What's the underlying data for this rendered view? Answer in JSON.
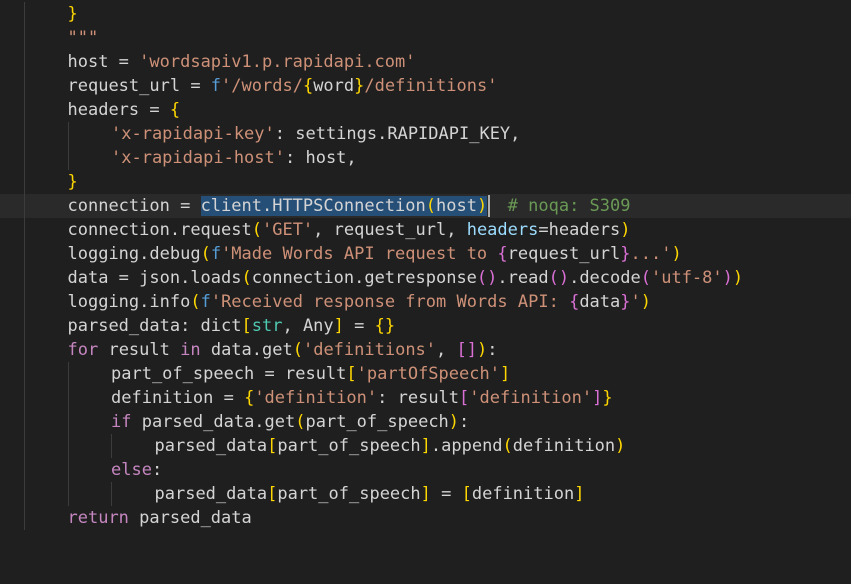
{
  "editor": {
    "language": "python",
    "lines": [
      {
        "indent": 1,
        "tokens": [
          {
            "t": "}",
            "c": "br1"
          }
        ]
      },
      {
        "indent": 1,
        "tokens": [
          {
            "t": "\"\"\"",
            "c": "str"
          }
        ]
      },
      {
        "indent": 1,
        "tokens": [
          {
            "t": "host = ",
            "c": "plain"
          },
          {
            "t": "'wordsapiv1.p.rapidapi.com'",
            "c": "str"
          }
        ]
      },
      {
        "indent": 1,
        "tokens": [
          {
            "t": "request_url = ",
            "c": "plain"
          },
          {
            "t": "f",
            "c": "kw2"
          },
          {
            "t": "'/words/",
            "c": "str"
          },
          {
            "t": "{",
            "c": "br1"
          },
          {
            "t": "word",
            "c": "plain"
          },
          {
            "t": "}",
            "c": "br1"
          },
          {
            "t": "/definitions'",
            "c": "str"
          }
        ]
      },
      {
        "indent": 1,
        "tokens": [
          {
            "t": "headers = ",
            "c": "plain"
          },
          {
            "t": "{",
            "c": "br1"
          }
        ]
      },
      {
        "indent": 2,
        "tokens": [
          {
            "t": "'x-rapidapi-key'",
            "c": "str"
          },
          {
            "t": ": settings.RAPIDAPI_KEY,",
            "c": "plain"
          }
        ]
      },
      {
        "indent": 2,
        "tokens": [
          {
            "t": "'x-rapidapi-host'",
            "c": "str"
          },
          {
            "t": ": host,",
            "c": "plain"
          }
        ]
      },
      {
        "indent": 1,
        "tokens": [
          {
            "t": "}",
            "c": "br1"
          }
        ]
      },
      {
        "indent": 1,
        "current": true,
        "tokens": [
          {
            "t": "connection = ",
            "c": "plain"
          },
          {
            "t": "client.HTTPSConnection",
            "c": "plain",
            "sel": true
          },
          {
            "t": "(",
            "c": "br1",
            "sel": true
          },
          {
            "t": "host",
            "c": "plain",
            "sel": true
          },
          {
            "t": ")",
            "c": "br1",
            "sel": true
          },
          {
            "t": "  ",
            "c": "plain"
          },
          {
            "t": "# noqa: S309",
            "c": "cmt"
          }
        ]
      },
      {
        "indent": 1,
        "tokens": [
          {
            "t": "connection.request",
            "c": "plain"
          },
          {
            "t": "(",
            "c": "br1"
          },
          {
            "t": "'GET'",
            "c": "str"
          },
          {
            "t": ", request_url, ",
            "c": "plain"
          },
          {
            "t": "headers",
            "c": "param"
          },
          {
            "t": "=headers",
            "c": "plain"
          },
          {
            "t": ")",
            "c": "br1"
          }
        ]
      },
      {
        "indent": 1,
        "tokens": [
          {
            "t": "logging.debug",
            "c": "plain"
          },
          {
            "t": "(",
            "c": "br1"
          },
          {
            "t": "f",
            "c": "kw2"
          },
          {
            "t": "'Made Words API request to ",
            "c": "str"
          },
          {
            "t": "{",
            "c": "br2"
          },
          {
            "t": "request_url",
            "c": "plain"
          },
          {
            "t": "}",
            "c": "br2"
          },
          {
            "t": "...'",
            "c": "str"
          },
          {
            "t": ")",
            "c": "br1"
          }
        ]
      },
      {
        "indent": 1,
        "tokens": [
          {
            "t": "data = json.loads",
            "c": "plain"
          },
          {
            "t": "(",
            "c": "br1"
          },
          {
            "t": "connection.getresponse",
            "c": "plain"
          },
          {
            "t": "()",
            "c": "br2"
          },
          {
            "t": ".read",
            "c": "plain"
          },
          {
            "t": "()",
            "c": "br2"
          },
          {
            "t": ".decode",
            "c": "plain"
          },
          {
            "t": "(",
            "c": "br2"
          },
          {
            "t": "'utf-8'",
            "c": "str"
          },
          {
            "t": ")",
            "c": "br2"
          },
          {
            "t": ")",
            "c": "br1"
          }
        ]
      },
      {
        "indent": 1,
        "tokens": [
          {
            "t": "logging.info",
            "c": "plain"
          },
          {
            "t": "(",
            "c": "br1"
          },
          {
            "t": "f",
            "c": "kw2"
          },
          {
            "t": "'Received response from Words API: ",
            "c": "str"
          },
          {
            "t": "{",
            "c": "br2"
          },
          {
            "t": "data",
            "c": "plain"
          },
          {
            "t": "}",
            "c": "br2"
          },
          {
            "t": "'",
            "c": "str"
          },
          {
            "t": ")",
            "c": "br1"
          }
        ]
      },
      {
        "indent": 1,
        "tokens": [
          {
            "t": "parsed_data: dict",
            "c": "plain"
          },
          {
            "t": "[",
            "c": "br1"
          },
          {
            "t": "str",
            "c": "type"
          },
          {
            "t": ", Any",
            "c": "plain"
          },
          {
            "t": "]",
            "c": "br1"
          },
          {
            "t": " = ",
            "c": "plain"
          },
          {
            "t": "{}",
            "c": "br1"
          }
        ]
      },
      {
        "indent": 1,
        "tokens": [
          {
            "t": "for",
            "c": "kw"
          },
          {
            "t": " result ",
            "c": "plain"
          },
          {
            "t": "in",
            "c": "kw"
          },
          {
            "t": " data.get",
            "c": "plain"
          },
          {
            "t": "(",
            "c": "br1"
          },
          {
            "t": "'definitions'",
            "c": "str"
          },
          {
            "t": ", ",
            "c": "plain"
          },
          {
            "t": "[]",
            "c": "br2"
          },
          {
            "t": ")",
            "c": "br1"
          },
          {
            "t": ":",
            "c": "plain"
          }
        ]
      },
      {
        "indent": 2,
        "tokens": [
          {
            "t": "part_of_speech = result",
            "c": "plain"
          },
          {
            "t": "[",
            "c": "br1"
          },
          {
            "t": "'partOfSpeech'",
            "c": "str"
          },
          {
            "t": "]",
            "c": "br1"
          }
        ]
      },
      {
        "indent": 2,
        "tokens": [
          {
            "t": "definition = ",
            "c": "plain"
          },
          {
            "t": "{",
            "c": "br1"
          },
          {
            "t": "'definition'",
            "c": "str"
          },
          {
            "t": ": result",
            "c": "plain"
          },
          {
            "t": "[",
            "c": "br2"
          },
          {
            "t": "'definition'",
            "c": "str"
          },
          {
            "t": "]",
            "c": "br2"
          },
          {
            "t": "}",
            "c": "br1"
          }
        ]
      },
      {
        "indent": 2,
        "tokens": [
          {
            "t": "if",
            "c": "kw"
          },
          {
            "t": " parsed_data.get",
            "c": "plain"
          },
          {
            "t": "(",
            "c": "br1"
          },
          {
            "t": "part_of_speech",
            "c": "plain"
          },
          {
            "t": ")",
            "c": "br1"
          },
          {
            "t": ":",
            "c": "plain"
          }
        ]
      },
      {
        "indent": 3,
        "tokens": [
          {
            "t": "parsed_data",
            "c": "plain"
          },
          {
            "t": "[",
            "c": "br1"
          },
          {
            "t": "part_of_speech",
            "c": "plain"
          },
          {
            "t": "]",
            "c": "br1"
          },
          {
            "t": ".append",
            "c": "plain"
          },
          {
            "t": "(",
            "c": "br1"
          },
          {
            "t": "definition",
            "c": "plain"
          },
          {
            "t": ")",
            "c": "br1"
          }
        ]
      },
      {
        "indent": 2,
        "tokens": [
          {
            "t": "else",
            "c": "kw"
          },
          {
            "t": ":",
            "c": "plain"
          }
        ]
      },
      {
        "indent": 3,
        "tokens": [
          {
            "t": "parsed_data",
            "c": "plain"
          },
          {
            "t": "[",
            "c": "br1"
          },
          {
            "t": "part_of_speech",
            "c": "plain"
          },
          {
            "t": "]",
            "c": "br1"
          },
          {
            "t": " = ",
            "c": "plain"
          },
          {
            "t": "[",
            "c": "br1"
          },
          {
            "t": "definition",
            "c": "plain"
          },
          {
            "t": "]",
            "c": "br1"
          }
        ]
      },
      {
        "indent": 1,
        "tokens": [
          {
            "t": "return",
            "c": "kw"
          },
          {
            "t": " parsed_data",
            "c": "plain"
          }
        ]
      }
    ]
  }
}
